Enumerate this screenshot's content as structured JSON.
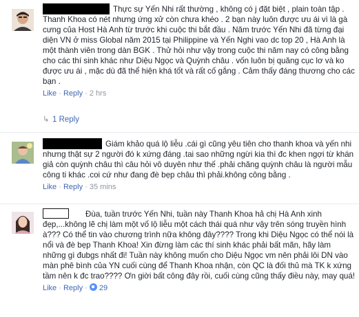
{
  "comments": [
    {
      "text": "Thực sự Yến Nhi rất thường , không có j đặt biệt , plain toàn tập . Thanh Khoa có nét nhưng ứng xử còn chưa khéo . 2 bạn này luôn được ưu ái vì là gà cưng của Host Hà Anh từ trước khi cuộc thi bắt đầu . Năm trước Yến Nhi đã từng đại diện VN ở miss Global năm 2015 tại Philippine và Yến Nghi vao dc top 20 , Hà Anh là một thành viên trong dàn BGK . Thử hỏi như vậy trong cuộc thi năm nay có công bằng cho các thí sinh khác như Diệu Ngọc và Quỳnh châu . vốn luôn bị quăng cục lơ và ko được ưu ái , mặc dù đã thể hiện khá tốt và rất cố gắng . Cảm thấy đáng thương cho các bạn .",
      "like_label": "Like",
      "reply_label": "Reply",
      "time": "2 hrs",
      "replies_label": "1 Reply"
    },
    {
      "text": "Giám khảo quá lộ liễu .cái gì cũng yêu tiên cho thanh khoa và yến nhi nhưng thật sự 2 người đó k xứng đáng .tai sao những ngừi kia thì đc khen ngợi từ khán giả còn quỳnh châu thì câu hỏi vô duyên như thế .phải chăng quỳnh châu là người mẫu công ti khác .coi cứ như đang đè bẹp châu thì phải.không công bằng .",
      "like_label": "Like",
      "reply_label": "Reply",
      "time": "35 mins"
    },
    {
      "text": "Đùa, tuần trước Yến Nhi, tuần này Thanh Khoa hả chị Hà Anh xinh đẹp,...không lẽ chị làm một vố lộ liễu một cách thái quá như vậy trên sóng truyền hình à??? Có thể tin vào chương trình nữa không đây???? Trong khi Diệu Ngọc có thể nói là nổi và đè bẹp Thanh Khoa! Xin đừng làm các thí sinh khác phải bất mãn, hãy làm những gì đubgs nhất đi! Tuần này không muốn cho Diệu Ngọc vm nên phải lôi DN vào màn phê bình của YN cuối cùng để Thanh Khoa nhận, còn QC là đối thủ mà TK k xứng tầm nên k đc trao???? Ơn giời bất công đây rồi, cuối cùng cũng thấy điều này, may quá!",
      "like_label": "Like",
      "reply_label": "Reply",
      "likes": "29"
    }
  ],
  "colors": {
    "link": "#4267b2",
    "meta": "#90949c",
    "text": "#1d2129"
  }
}
